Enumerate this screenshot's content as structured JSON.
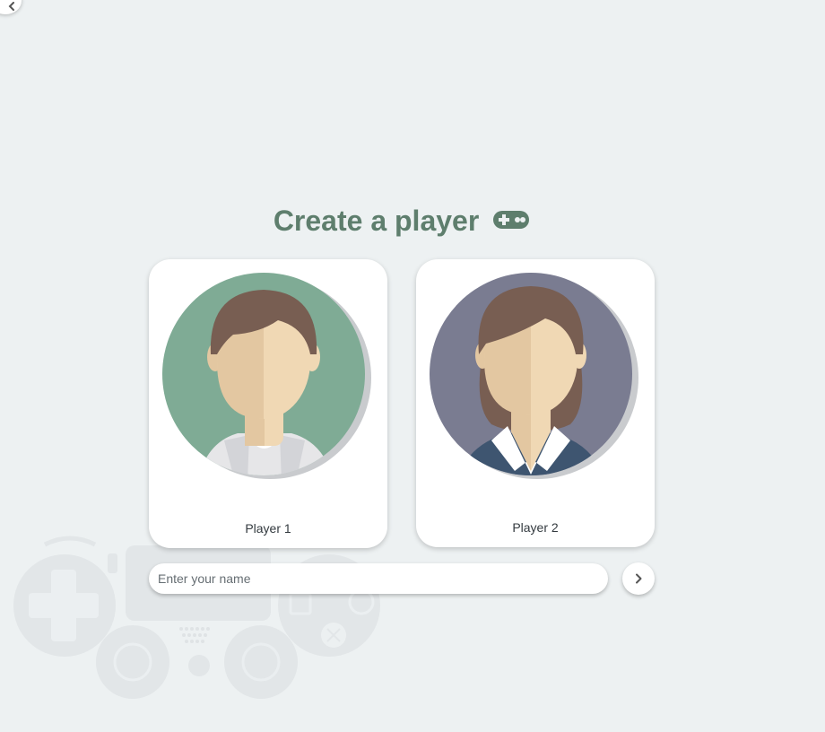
{
  "header": {
    "title": "Create a player",
    "title_icon": "gamepad-icon",
    "back_icon": "chevron-left-icon"
  },
  "players": [
    {
      "label": "Player 1",
      "avatar": "male-avatar",
      "bg_color": "#7fab95"
    },
    {
      "label": "Player 2",
      "avatar": "female-avatar",
      "bg_color": "#7a7c91"
    }
  ],
  "name_input": {
    "value": "",
    "placeholder": "Enter your name"
  },
  "submit": {
    "icon": "chevron-right-icon"
  },
  "colors": {
    "background": "#edf1f2",
    "title": "#5e7e6d",
    "card": "#ffffff"
  }
}
